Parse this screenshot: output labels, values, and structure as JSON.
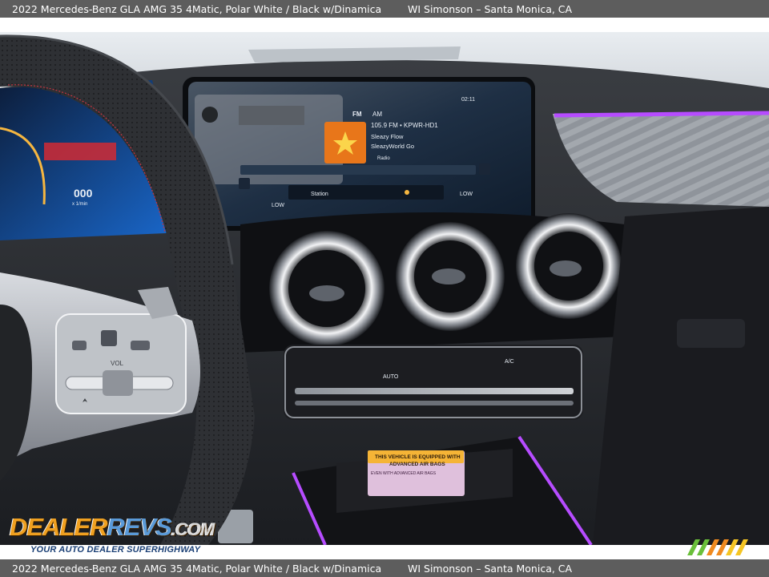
{
  "caption": {
    "vehicle": "2022 Mercedes-Benz GLA AMG 35  4Matic,   Polar White / Black w/Dinamica",
    "dealer": "WI Simonson – Santa Monica, CA"
  },
  "screen": {
    "band_fm": "FM",
    "band_am": "AM",
    "clock": "02:11",
    "station": "105.9 FM • KPWR-HD1",
    "track_1": "Sleazy Flow",
    "track_2": "SleazyWorld Go",
    "tag": "Radio",
    "station_btn": "Station",
    "sound_low": "LOW",
    "sound_low_right": "LOW",
    "gauge_value": "000",
    "gauge_unit": "x 1/min"
  },
  "controls": {
    "auto": "AUTO",
    "ac": "A/C",
    "vol": "VOL"
  },
  "airbag_label": {
    "line1": "THIS VEHICLE IS EQUIPPED WITH",
    "line2": "ADVANCED AIR BAGS",
    "line3": "EVEN WITH ADVANCED AIR BAGS"
  },
  "watermark": {
    "brand_a": "DEALER",
    "brand_b": "REVS",
    "brand_c": ".COM",
    "tagline": "YOUR AUTO DEALER SUPERHIGHWAY"
  },
  "colors": {
    "ambient": "#b64cff",
    "caption_bar": "#5d5d5d",
    "brand_orange": "#f0a020"
  }
}
